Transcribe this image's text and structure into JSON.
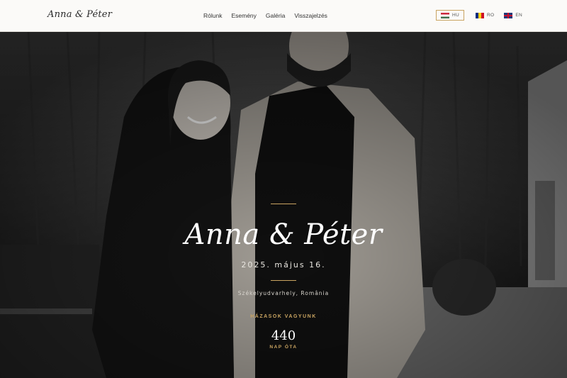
{
  "header": {
    "brand": "Anna & Péter",
    "nav": [
      "Rólunk",
      "Esemény",
      "Galéria",
      "Visszajelzés"
    ],
    "languages": [
      {
        "code": "HU",
        "flag": "hu-flag-icon",
        "active": true
      },
      {
        "code": "RO",
        "flag": "ro-flag-icon",
        "active": false
      },
      {
        "code": "EN",
        "flag": "uk-flag-icon",
        "active": false
      }
    ]
  },
  "hero": {
    "names": "Anna & Péter",
    "date": "2025. május 16.",
    "location": "Székelyudvarhely, România",
    "status": "HÁZASOK VAGYUNK",
    "days_count": "440",
    "days_label": "NAP ÓTA"
  },
  "colors": {
    "accent_gold": "#c9a461",
    "header_bg": "#fbfaf8",
    "text_dark": "#2a2a2a"
  }
}
